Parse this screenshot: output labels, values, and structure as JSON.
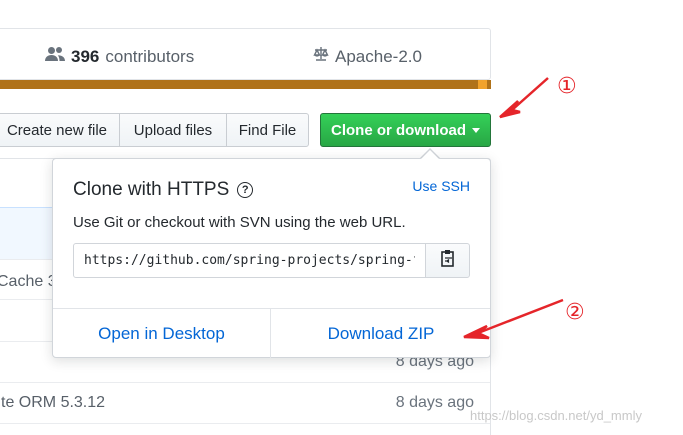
{
  "summary": {
    "contributors_count": "396",
    "contributors_label": "contributors",
    "license": "Apache-2.0"
  },
  "buttons": {
    "create_new_file": "Create new file",
    "upload_files": "Upload files",
    "find_file": "Find File",
    "clone_or_download": "Clone or download"
  },
  "file_list": {
    "partial_rows": [
      {
        "text": "Cache 3",
        "date": ""
      },
      {
        "text": "",
        "date": "8 days ago"
      },
      {
        "text": "te ORM 5.3.12",
        "date": "8 days ago"
      }
    ]
  },
  "clone_popover": {
    "title": "Clone with HTTPS",
    "use_ssh": "Use SSH",
    "description": "Use Git or checkout with SVN using the web URL.",
    "url_value": "https://github.com/spring-projects/spring-framework.git",
    "open_in_desktop": "Open in Desktop",
    "download_zip": "Download ZIP"
  },
  "annotations": {
    "marker_1": "①",
    "marker_2": "②",
    "watermark": "https://blog.csdn.net/yd_mmly"
  },
  "colors": {
    "clone_button": "#28a745",
    "link": "#0366d6",
    "annotation": "#e5252a",
    "language_bar": "#b07219"
  }
}
